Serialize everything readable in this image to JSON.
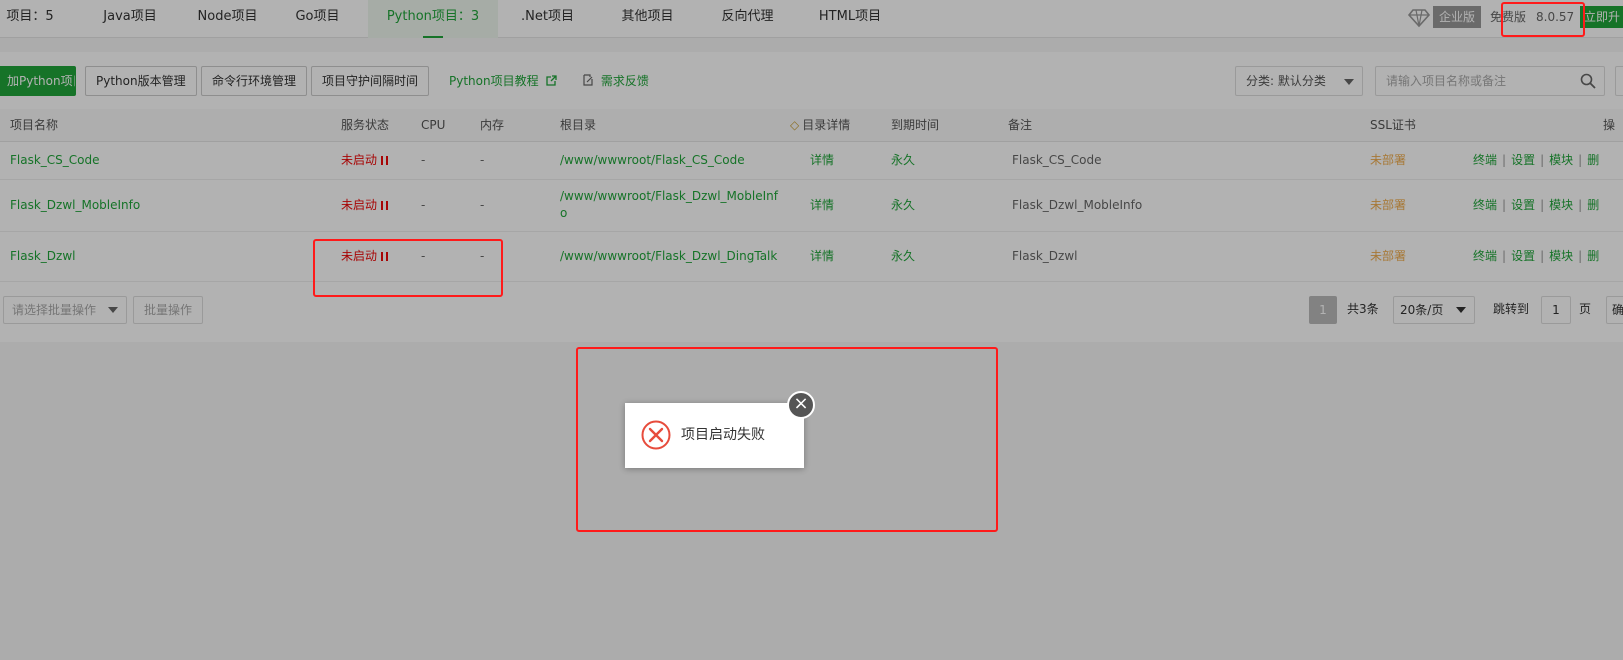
{
  "tabs": [
    {
      "label": "项目：5"
    },
    {
      "label": "Java项目"
    },
    {
      "label": "Node项目"
    },
    {
      "label": "Go项目"
    },
    {
      "label": "Python项目：3"
    },
    {
      "label": ".Net项目"
    },
    {
      "label": "其他项目"
    },
    {
      "label": "反向代理"
    },
    {
      "label": "HTML项目"
    }
  ],
  "header_right": {
    "enterprise_label": "企业版",
    "free_label": "免费版",
    "version": "8.0.57",
    "upgrade_label": "立即升"
  },
  "toolbar": {
    "add_button": "加Python项目",
    "version_mgmt": "Python版本管理",
    "cmd_env": "命令行环境管理",
    "guard_interval": "项目守护间隔时间",
    "tutorial": "Python项目教程",
    "feedback": "需求反馈",
    "category_select": "分类: 默认分类",
    "search_placeholder": "请输入项目名称或备注"
  },
  "table": {
    "headers": [
      "项目名称",
      "服务状态",
      "CPU",
      "内存",
      "根目录",
      "目录详情",
      "到期时间",
      "备注",
      "SSL证书",
      "操"
    ],
    "rows": [
      {
        "name": "Flask_CS_Code",
        "status": "未启动",
        "cpu": "-",
        "mem": "-",
        "root": "/www/wwwroot/Flask_CS_Code",
        "detail": "详情",
        "expire": "永久",
        "note": "Flask_CS_Code",
        "ssl": "未部署"
      },
      {
        "name": "Flask_Dzwl_MobleInfo",
        "status": "未启动",
        "cpu": "-",
        "mem": "-",
        "root": "/www/wwwroot/Flask_Dzwl_MobleInfo",
        "detail": "详情",
        "expire": "永久",
        "note": "Flask_Dzwl_MobleInfo",
        "ssl": "未部署"
      },
      {
        "name": "Flask_Dzwl",
        "status": "未启动",
        "cpu": "-",
        "mem": "-",
        "root": "/www/wwwroot/Flask_Dzwl_DingTalk",
        "detail": "详情",
        "expire": "永久",
        "note": "Flask_Dzwl",
        "ssl": "未部署"
      }
    ],
    "ops": [
      "终端",
      "设置",
      "模块",
      "删"
    ]
  },
  "footer": {
    "batch_select": "请选择批量操作",
    "batch_button": "批量操作",
    "current_page": "1",
    "total": "共3条",
    "page_size": "20条/页",
    "jump_label": "跳转到",
    "jump_value": "1",
    "page_unit": "页",
    "confirm": "确"
  },
  "toast": {
    "message": "项目启动失败",
    "icon": "error-x-icon"
  },
  "colors": {
    "accent": "#20a53a",
    "danger": "#ef0808",
    "warning": "#f0ad4e",
    "highlight_box": "#ff1a1a"
  }
}
